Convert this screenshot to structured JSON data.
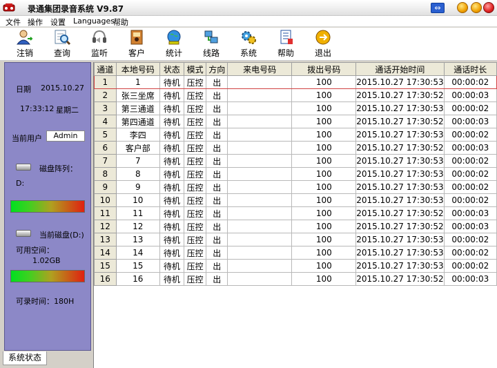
{
  "title": "录通集团录音系统 V9.87",
  "window_buttons": {
    "restore": "⇔"
  },
  "menu": [
    "文件",
    "操作",
    "设置",
    "Languages",
    "帮助"
  ],
  "toolbar": [
    {
      "label": "注销",
      "icon": "logout-user-icon"
    },
    {
      "label": "查询",
      "icon": "search-document-icon"
    },
    {
      "label": "监听",
      "icon": "headset-icon"
    },
    {
      "label": "客户",
      "icon": "contacts-book-icon"
    },
    {
      "label": "统计",
      "icon": "statistics-globe-icon"
    },
    {
      "label": "线路",
      "icon": "network-lines-icon"
    },
    {
      "label": "系统",
      "icon": "gears-icon"
    },
    {
      "label": "帮助",
      "icon": "help-book-icon"
    },
    {
      "label": "退出",
      "icon": "exit-icon"
    }
  ],
  "status": {
    "date_label": "日期",
    "date_value": "2015.10.27",
    "time_value": "17:33:12",
    "weekday": "星期二",
    "user_label": "当前用户",
    "user_value": "Admin",
    "disk_array_label": "磁盘阵列：",
    "disk_array_value": "D:",
    "current_disk_label": "当前磁盘(D:)",
    "free_space_label": "可用空间：",
    "free_space_value": "1.02GB",
    "record_time": "可录时间：180H"
  },
  "tab_label": "系统状态",
  "table": {
    "columns": [
      "通道",
      "本地号码",
      "状态",
      "模式",
      "方向",
      "来电号码",
      "拨出号码",
      "通话开始时间",
      "通话时长"
    ],
    "rows": [
      [
        "1",
        "1",
        "待机",
        "压控",
        "出",
        "",
        "100",
        "2015.10.27 17:30:53",
        "00:00:02"
      ],
      [
        "2",
        "张三坐席",
        "待机",
        "压控",
        "出",
        "",
        "100",
        "2015.10.27 17:30:52",
        "00:00:03"
      ],
      [
        "3",
        "第三通道",
        "待机",
        "压控",
        "出",
        "",
        "100",
        "2015.10.27 17:30:53",
        "00:00:02"
      ],
      [
        "4",
        "第四通道",
        "待机",
        "压控",
        "出",
        "",
        "100",
        "2015.10.27 17:30:52",
        "00:00:03"
      ],
      [
        "5",
        "李四",
        "待机",
        "压控",
        "出",
        "",
        "100",
        "2015.10.27 17:30:53",
        "00:00:02"
      ],
      [
        "6",
        "客户部",
        "待机",
        "压控",
        "出",
        "",
        "100",
        "2015.10.27 17:30:52",
        "00:00:03"
      ],
      [
        "7",
        "7",
        "待机",
        "压控",
        "出",
        "",
        "100",
        "2015.10.27 17:30:53",
        "00:00:02"
      ],
      [
        "8",
        "8",
        "待机",
        "压控",
        "出",
        "",
        "100",
        "2015.10.27 17:30:53",
        "00:00:02"
      ],
      [
        "9",
        "9",
        "待机",
        "压控",
        "出",
        "",
        "100",
        "2015.10.27 17:30:53",
        "00:00:02"
      ],
      [
        "10",
        "10",
        "待机",
        "压控",
        "出",
        "",
        "100",
        "2015.10.27 17:30:53",
        "00:00:02"
      ],
      [
        "11",
        "11",
        "待机",
        "压控",
        "出",
        "",
        "100",
        "2015.10.27 17:30:52",
        "00:00:03"
      ],
      [
        "12",
        "12",
        "待机",
        "压控",
        "出",
        "",
        "100",
        "2015.10.27 17:30:52",
        "00:00:03"
      ],
      [
        "13",
        "13",
        "待机",
        "压控",
        "出",
        "",
        "100",
        "2015.10.27 17:30:53",
        "00:00:02"
      ],
      [
        "14",
        "14",
        "待机",
        "压控",
        "出",
        "",
        "100",
        "2015.10.27 17:30:53",
        "00:00:02"
      ],
      [
        "15",
        "15",
        "待机",
        "压控",
        "出",
        "",
        "100",
        "2015.10.27 17:30:53",
        "00:00:02"
      ],
      [
        "16",
        "16",
        "待机",
        "压控",
        "出",
        "",
        "100",
        "2015.10.27 17:30:52",
        "00:00:03"
      ]
    ],
    "selected_row": 0
  },
  "colors": {
    "panel": "#8c88c7",
    "selection": "#d04040",
    "header": "#ece9d8"
  }
}
